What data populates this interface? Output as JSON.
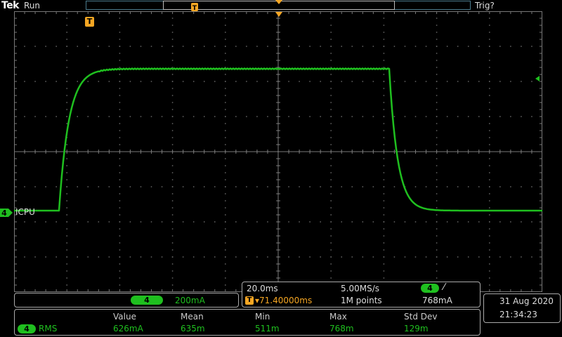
{
  "header": {
    "brand": "Tek",
    "run_status": "Run",
    "trigger_status": "Trig?"
  },
  "channel": {
    "number": "4",
    "label": "ICPU",
    "scale": "200mA",
    "color": "#1fbf1f"
  },
  "trigger": {
    "marker": "T",
    "color": "#f5a623"
  },
  "timebase": {
    "time_per_div": "20.0ms",
    "sample_rate": "5.00MS/s",
    "trigger_position": "▾71.40000ms",
    "record_length": "1M points",
    "trigger_level": "768mA",
    "trigger_slope": "⁄"
  },
  "datetime": {
    "date": "31 Aug 2020",
    "time": "21:34:23"
  },
  "measurement": {
    "headers": [
      "Value",
      "Mean",
      "Min",
      "Max",
      "Std Dev"
    ],
    "name": "RMS",
    "values": [
      "626mA",
      "635m",
      "511m",
      "768m",
      "129m"
    ]
  },
  "waveform_levels": {
    "low_mA": 0,
    "high_mA": 800
  }
}
